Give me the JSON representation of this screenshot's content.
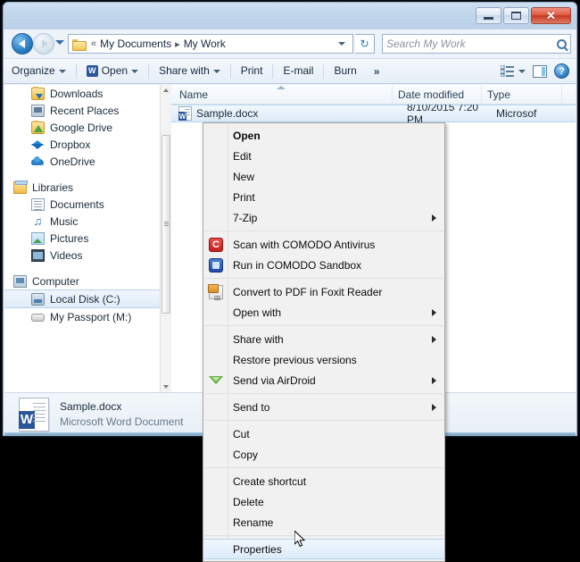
{
  "window": {
    "controls": {
      "minimize": "Minimize",
      "maximize": "Maximize",
      "close": "Close"
    }
  },
  "address_bar": {
    "back_tooltip": "Back",
    "forward_tooltip": "Forward",
    "breadcrumbs": [
      "My Documents",
      "My Work"
    ],
    "overflow_marker": "«",
    "separator": "▸",
    "refresh_label": "↻"
  },
  "search": {
    "placeholder": "Search My Work",
    "value": "Search My Work"
  },
  "toolbar": {
    "organize": "Organize",
    "open": "Open",
    "share_with": "Share with",
    "print": "Print",
    "email": "E-mail",
    "burn": "Burn",
    "overflow": "»",
    "help": "?"
  },
  "navigation_pane": {
    "items": [
      {
        "label": "Downloads",
        "icon": "downloads-folder-icon",
        "indent": 2,
        "selected": false
      },
      {
        "label": "Recent Places",
        "icon": "recent-places-icon",
        "indent": 2,
        "selected": false
      },
      {
        "label": "Google Drive",
        "icon": "google-drive-icon",
        "indent": 2,
        "selected": false
      },
      {
        "label": "Dropbox",
        "icon": "dropbox-icon",
        "indent": 2,
        "selected": false
      },
      {
        "label": "OneDrive",
        "icon": "onedrive-icon",
        "indent": 2,
        "selected": false
      },
      {
        "label": "Libraries",
        "icon": "libraries-icon",
        "indent": 1,
        "selected": false
      },
      {
        "label": "Documents",
        "icon": "documents-library-icon",
        "indent": 2,
        "selected": false
      },
      {
        "label": "Music",
        "icon": "music-library-icon",
        "indent": 2,
        "selected": false
      },
      {
        "label": "Pictures",
        "icon": "pictures-library-icon",
        "indent": 2,
        "selected": false
      },
      {
        "label": "Videos",
        "icon": "videos-library-icon",
        "indent": 2,
        "selected": false
      },
      {
        "label": "Computer",
        "icon": "computer-icon",
        "indent": 1,
        "selected": false
      },
      {
        "label": "Local Disk (C:)",
        "icon": "local-disk-icon",
        "indent": 2,
        "selected": true
      },
      {
        "label": "My Passport (M:)",
        "icon": "external-drive-icon",
        "indent": 2,
        "selected": false
      }
    ]
  },
  "file_list": {
    "columns": [
      "Name",
      "Date modified",
      "Type"
    ],
    "sorted_column": "Name",
    "rows": [
      {
        "name": "Sample.docx",
        "date_modified": "8/10/2015 7:20 PM",
        "type": "Microsof",
        "icon": "word-document-icon",
        "selected": true
      }
    ]
  },
  "details_pane": {
    "title": "Sample.docx",
    "subtitle": "Microsoft Word Document",
    "icon": "word-document-icon"
  },
  "context_menu": {
    "items": [
      {
        "label": "Open",
        "bold": true,
        "submenu": false,
        "icon": null,
        "separator_after": false
      },
      {
        "label": "Edit",
        "bold": false,
        "submenu": false,
        "icon": null,
        "separator_after": false
      },
      {
        "label": "New",
        "bold": false,
        "submenu": false,
        "icon": null,
        "separator_after": false
      },
      {
        "label": "Print",
        "bold": false,
        "submenu": false,
        "icon": null,
        "separator_after": false
      },
      {
        "label": "7-Zip",
        "bold": false,
        "submenu": true,
        "icon": null,
        "separator_after": true
      },
      {
        "label": "Scan with COMODO Antivirus",
        "bold": false,
        "submenu": false,
        "icon": "comodo-antivirus-icon",
        "separator_after": false
      },
      {
        "label": "Run in COMODO Sandbox",
        "bold": false,
        "submenu": false,
        "icon": "comodo-sandbox-icon",
        "separator_after": true
      },
      {
        "label": "Convert to PDF in Foxit Reader",
        "bold": false,
        "submenu": false,
        "icon": "foxit-pdf-icon",
        "separator_after": false
      },
      {
        "label": "Open with",
        "bold": false,
        "submenu": true,
        "icon": null,
        "separator_after": true
      },
      {
        "label": "Share with",
        "bold": false,
        "submenu": true,
        "icon": null,
        "separator_after": false
      },
      {
        "label": "Restore previous versions",
        "bold": false,
        "submenu": false,
        "icon": null,
        "separator_after": false
      },
      {
        "label": "Send via AirDroid",
        "bold": false,
        "submenu": true,
        "icon": "airdroid-icon",
        "separator_after": true
      },
      {
        "label": "Send to",
        "bold": false,
        "submenu": true,
        "icon": null,
        "separator_after": true
      },
      {
        "label": "Cut",
        "bold": false,
        "submenu": false,
        "icon": null,
        "separator_after": false
      },
      {
        "label": "Copy",
        "bold": false,
        "submenu": false,
        "icon": null,
        "separator_after": true
      },
      {
        "label": "Create shortcut",
        "bold": false,
        "submenu": false,
        "icon": null,
        "separator_after": false
      },
      {
        "label": "Delete",
        "bold": false,
        "submenu": false,
        "icon": null,
        "separator_after": false
      },
      {
        "label": "Rename",
        "bold": false,
        "submenu": false,
        "icon": null,
        "separator_after": true
      },
      {
        "label": "Properties",
        "bold": false,
        "submenu": false,
        "icon": null,
        "separator_after": false,
        "highlighted": true
      }
    ]
  },
  "colors": {
    "accent": "#2b579a",
    "selection": "#dcebfa",
    "titlebar": "#c0d4ea",
    "close_button": "#c43a22"
  }
}
